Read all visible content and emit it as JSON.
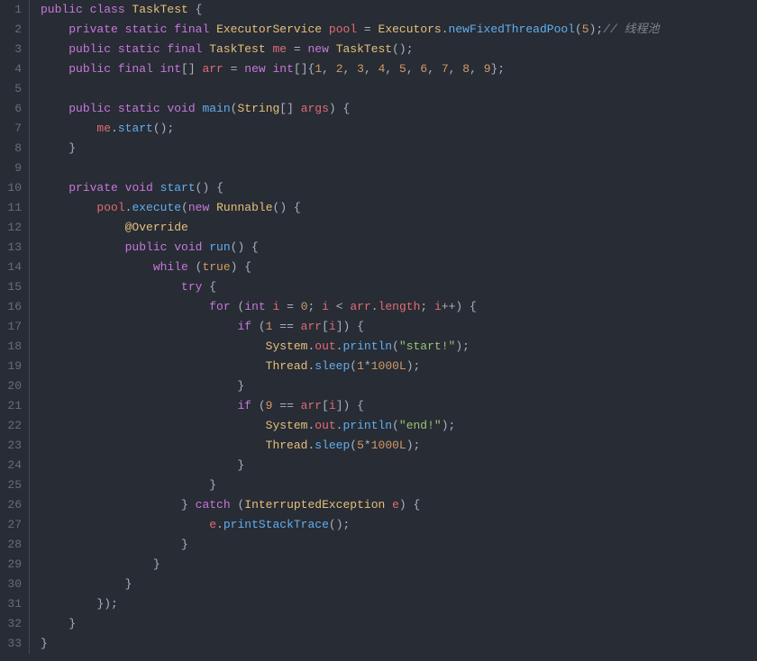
{
  "lines": [
    {
      "n": "1",
      "frags": [
        {
          "t": "public ",
          "c": "kw"
        },
        {
          "t": "class ",
          "c": "kw"
        },
        {
          "t": "TaskTest ",
          "c": "cls"
        },
        {
          "t": "{",
          "c": "punct"
        }
      ]
    },
    {
      "n": "2",
      "frags": [
        {
          "t": "    ",
          "c": ""
        },
        {
          "t": "private ",
          "c": "kw"
        },
        {
          "t": "static ",
          "c": "kw"
        },
        {
          "t": "final ",
          "c": "kw"
        },
        {
          "t": "ExecutorService ",
          "c": "cls"
        },
        {
          "t": "pool ",
          "c": "var"
        },
        {
          "t": "= ",
          "c": "op"
        },
        {
          "t": "Executors",
          "c": "cls"
        },
        {
          "t": ".",
          "c": "punct"
        },
        {
          "t": "newFixedThreadPool",
          "c": "fn"
        },
        {
          "t": "(",
          "c": "punct"
        },
        {
          "t": "5",
          "c": "num"
        },
        {
          "t": ");",
          "c": "punct"
        },
        {
          "t": "// 线程池",
          "c": "comment"
        }
      ]
    },
    {
      "n": "3",
      "frags": [
        {
          "t": "    ",
          "c": ""
        },
        {
          "t": "public ",
          "c": "kw"
        },
        {
          "t": "static ",
          "c": "kw"
        },
        {
          "t": "final ",
          "c": "kw"
        },
        {
          "t": "TaskTest ",
          "c": "cls"
        },
        {
          "t": "me ",
          "c": "var"
        },
        {
          "t": "= ",
          "c": "op"
        },
        {
          "t": "new ",
          "c": "kw"
        },
        {
          "t": "TaskTest",
          "c": "cls"
        },
        {
          "t": "();",
          "c": "punct"
        }
      ]
    },
    {
      "n": "4",
      "frags": [
        {
          "t": "    ",
          "c": ""
        },
        {
          "t": "public ",
          "c": "kw"
        },
        {
          "t": "final ",
          "c": "kw"
        },
        {
          "t": "int",
          "c": "kw"
        },
        {
          "t": "[] ",
          "c": "punct"
        },
        {
          "t": "arr ",
          "c": "var"
        },
        {
          "t": "= ",
          "c": "op"
        },
        {
          "t": "new ",
          "c": "kw"
        },
        {
          "t": "int",
          "c": "kw"
        },
        {
          "t": "[]{",
          "c": "punct"
        },
        {
          "t": "1",
          "c": "num"
        },
        {
          "t": ", ",
          "c": "punct"
        },
        {
          "t": "2",
          "c": "num"
        },
        {
          "t": ", ",
          "c": "punct"
        },
        {
          "t": "3",
          "c": "num"
        },
        {
          "t": ", ",
          "c": "punct"
        },
        {
          "t": "4",
          "c": "num"
        },
        {
          "t": ", ",
          "c": "punct"
        },
        {
          "t": "5",
          "c": "num"
        },
        {
          "t": ", ",
          "c": "punct"
        },
        {
          "t": "6",
          "c": "num"
        },
        {
          "t": ", ",
          "c": "punct"
        },
        {
          "t": "7",
          "c": "num"
        },
        {
          "t": ", ",
          "c": "punct"
        },
        {
          "t": "8",
          "c": "num"
        },
        {
          "t": ", ",
          "c": "punct"
        },
        {
          "t": "9",
          "c": "num"
        },
        {
          "t": "};",
          "c": "punct"
        }
      ]
    },
    {
      "n": "5",
      "frags": []
    },
    {
      "n": "6",
      "frags": [
        {
          "t": "    ",
          "c": ""
        },
        {
          "t": "public ",
          "c": "kw"
        },
        {
          "t": "static ",
          "c": "kw"
        },
        {
          "t": "void ",
          "c": "kw"
        },
        {
          "t": "main",
          "c": "fn"
        },
        {
          "t": "(",
          "c": "punct"
        },
        {
          "t": "String",
          "c": "cls"
        },
        {
          "t": "[] ",
          "c": "punct"
        },
        {
          "t": "args",
          "c": "var"
        },
        {
          "t": ") {",
          "c": "punct"
        }
      ]
    },
    {
      "n": "7",
      "frags": [
        {
          "t": "        ",
          "c": ""
        },
        {
          "t": "me",
          "c": "var"
        },
        {
          "t": ".",
          "c": "punct"
        },
        {
          "t": "start",
          "c": "fn"
        },
        {
          "t": "();",
          "c": "punct"
        }
      ]
    },
    {
      "n": "8",
      "frags": [
        {
          "t": "    }",
          "c": "punct"
        }
      ]
    },
    {
      "n": "9",
      "frags": []
    },
    {
      "n": "10",
      "frags": [
        {
          "t": "    ",
          "c": ""
        },
        {
          "t": "private ",
          "c": "kw"
        },
        {
          "t": "void ",
          "c": "kw"
        },
        {
          "t": "start",
          "c": "fn"
        },
        {
          "t": "() {",
          "c": "punct"
        }
      ]
    },
    {
      "n": "11",
      "frags": [
        {
          "t": "        ",
          "c": ""
        },
        {
          "t": "pool",
          "c": "var"
        },
        {
          "t": ".",
          "c": "punct"
        },
        {
          "t": "execute",
          "c": "fn"
        },
        {
          "t": "(",
          "c": "punct"
        },
        {
          "t": "new ",
          "c": "kw"
        },
        {
          "t": "Runnable",
          "c": "cls"
        },
        {
          "t": "() {",
          "c": "punct"
        }
      ]
    },
    {
      "n": "12",
      "frags": [
        {
          "t": "            ",
          "c": ""
        },
        {
          "t": "@Override",
          "c": "annotation"
        }
      ]
    },
    {
      "n": "13",
      "frags": [
        {
          "t": "            ",
          "c": ""
        },
        {
          "t": "public ",
          "c": "kw"
        },
        {
          "t": "void ",
          "c": "kw"
        },
        {
          "t": "run",
          "c": "fn"
        },
        {
          "t": "() {",
          "c": "punct"
        }
      ]
    },
    {
      "n": "14",
      "frags": [
        {
          "t": "                ",
          "c": ""
        },
        {
          "t": "while ",
          "c": "kw"
        },
        {
          "t": "(",
          "c": "punct"
        },
        {
          "t": "true",
          "c": "const"
        },
        {
          "t": ") {",
          "c": "punct"
        }
      ]
    },
    {
      "n": "15",
      "frags": [
        {
          "t": "                    ",
          "c": ""
        },
        {
          "t": "try ",
          "c": "kw"
        },
        {
          "t": "{",
          "c": "punct"
        }
      ]
    },
    {
      "n": "16",
      "frags": [
        {
          "t": "                        ",
          "c": ""
        },
        {
          "t": "for ",
          "c": "kw"
        },
        {
          "t": "(",
          "c": "punct"
        },
        {
          "t": "int ",
          "c": "kw"
        },
        {
          "t": "i ",
          "c": "var"
        },
        {
          "t": "= ",
          "c": "op"
        },
        {
          "t": "0",
          "c": "num"
        },
        {
          "t": "; ",
          "c": "punct"
        },
        {
          "t": "i ",
          "c": "var"
        },
        {
          "t": "< ",
          "c": "op"
        },
        {
          "t": "arr",
          "c": "var"
        },
        {
          "t": ".",
          "c": "punct"
        },
        {
          "t": "length",
          "c": "var"
        },
        {
          "t": "; ",
          "c": "punct"
        },
        {
          "t": "i",
          "c": "var"
        },
        {
          "t": "++) {",
          "c": "punct"
        }
      ]
    },
    {
      "n": "17",
      "frags": [
        {
          "t": "                            ",
          "c": ""
        },
        {
          "t": "if ",
          "c": "kw"
        },
        {
          "t": "(",
          "c": "punct"
        },
        {
          "t": "1 ",
          "c": "num"
        },
        {
          "t": "== ",
          "c": "op"
        },
        {
          "t": "arr",
          "c": "var"
        },
        {
          "t": "[",
          "c": "punct"
        },
        {
          "t": "i",
          "c": "var"
        },
        {
          "t": "]) {",
          "c": "punct"
        }
      ]
    },
    {
      "n": "18",
      "frags": [
        {
          "t": "                                ",
          "c": ""
        },
        {
          "t": "System",
          "c": "cls"
        },
        {
          "t": ".",
          "c": "punct"
        },
        {
          "t": "out",
          "c": "var"
        },
        {
          "t": ".",
          "c": "punct"
        },
        {
          "t": "println",
          "c": "fn"
        },
        {
          "t": "(",
          "c": "punct"
        },
        {
          "t": "\"start!\"",
          "c": "str"
        },
        {
          "t": ");",
          "c": "punct"
        }
      ]
    },
    {
      "n": "19",
      "frags": [
        {
          "t": "                                ",
          "c": ""
        },
        {
          "t": "Thread",
          "c": "cls"
        },
        {
          "t": ".",
          "c": "punct"
        },
        {
          "t": "sleep",
          "c": "fn"
        },
        {
          "t": "(",
          "c": "punct"
        },
        {
          "t": "1",
          "c": "num"
        },
        {
          "t": "*",
          "c": "op"
        },
        {
          "t": "1000L",
          "c": "num"
        },
        {
          "t": ");",
          "c": "punct"
        }
      ]
    },
    {
      "n": "20",
      "frags": [
        {
          "t": "                            }",
          "c": "punct"
        }
      ]
    },
    {
      "n": "21",
      "frags": [
        {
          "t": "                            ",
          "c": ""
        },
        {
          "t": "if ",
          "c": "kw"
        },
        {
          "t": "(",
          "c": "punct"
        },
        {
          "t": "9 ",
          "c": "num"
        },
        {
          "t": "== ",
          "c": "op"
        },
        {
          "t": "arr",
          "c": "var"
        },
        {
          "t": "[",
          "c": "punct"
        },
        {
          "t": "i",
          "c": "var"
        },
        {
          "t": "]) {",
          "c": "punct"
        }
      ]
    },
    {
      "n": "22",
      "frags": [
        {
          "t": "                                ",
          "c": ""
        },
        {
          "t": "System",
          "c": "cls"
        },
        {
          "t": ".",
          "c": "punct"
        },
        {
          "t": "out",
          "c": "var"
        },
        {
          "t": ".",
          "c": "punct"
        },
        {
          "t": "println",
          "c": "fn"
        },
        {
          "t": "(",
          "c": "punct"
        },
        {
          "t": "\"end!\"",
          "c": "str"
        },
        {
          "t": ");",
          "c": "punct"
        }
      ]
    },
    {
      "n": "23",
      "frags": [
        {
          "t": "                                ",
          "c": ""
        },
        {
          "t": "Thread",
          "c": "cls"
        },
        {
          "t": ".",
          "c": "punct"
        },
        {
          "t": "sleep",
          "c": "fn"
        },
        {
          "t": "(",
          "c": "punct"
        },
        {
          "t": "5",
          "c": "num"
        },
        {
          "t": "*",
          "c": "op"
        },
        {
          "t": "1000L",
          "c": "num"
        },
        {
          "t": ");",
          "c": "punct"
        }
      ]
    },
    {
      "n": "24",
      "frags": [
        {
          "t": "                            }",
          "c": "punct"
        }
      ]
    },
    {
      "n": "25",
      "frags": [
        {
          "t": "                        }",
          "c": "punct"
        }
      ]
    },
    {
      "n": "26",
      "frags": [
        {
          "t": "                    } ",
          "c": "punct"
        },
        {
          "t": "catch ",
          "c": "kw"
        },
        {
          "t": "(",
          "c": "punct"
        },
        {
          "t": "InterruptedException ",
          "c": "cls"
        },
        {
          "t": "e",
          "c": "var"
        },
        {
          "t": ") {",
          "c": "punct"
        }
      ]
    },
    {
      "n": "27",
      "frags": [
        {
          "t": "                        ",
          "c": ""
        },
        {
          "t": "e",
          "c": "var"
        },
        {
          "t": ".",
          "c": "punct"
        },
        {
          "t": "printStackTrace",
          "c": "fn"
        },
        {
          "t": "();",
          "c": "punct"
        }
      ]
    },
    {
      "n": "28",
      "frags": [
        {
          "t": "                    }",
          "c": "punct"
        }
      ]
    },
    {
      "n": "29",
      "frags": [
        {
          "t": "                }",
          "c": "punct"
        }
      ]
    },
    {
      "n": "30",
      "frags": [
        {
          "t": "            }",
          "c": "punct"
        }
      ]
    },
    {
      "n": "31",
      "frags": [
        {
          "t": "        });",
          "c": "punct"
        }
      ]
    },
    {
      "n": "32",
      "frags": [
        {
          "t": "    }",
          "c": "punct"
        }
      ]
    },
    {
      "n": "33",
      "frags": [
        {
          "t": "}",
          "c": "punct"
        }
      ]
    }
  ]
}
